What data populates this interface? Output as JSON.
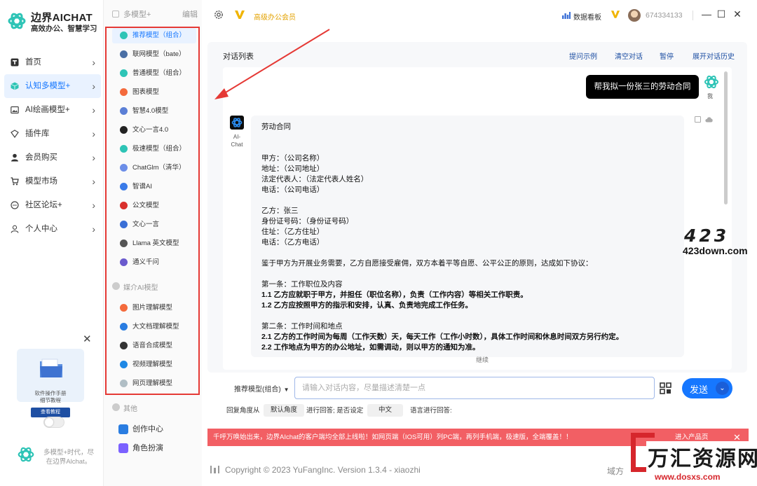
{
  "brand": {
    "name": "边界AICHAT",
    "slogan": "高效办公、智慧学习"
  },
  "nav": [
    {
      "label": "首页",
      "icon": "home-icon"
    },
    {
      "label": "认知多模型+",
      "icon": "cube-icon",
      "active": true
    },
    {
      "label": "AI绘画模型+",
      "icon": "image-icon"
    },
    {
      "label": "插件库",
      "icon": "plugin-icon"
    },
    {
      "label": "会员购买",
      "icon": "user-icon"
    },
    {
      "label": "模型市场",
      "icon": "cart-icon"
    },
    {
      "label": "社区论坛+",
      "icon": "chat-bubble-icon"
    },
    {
      "label": "个人中心",
      "icon": "person-icon"
    }
  ],
  "promo": {
    "line1": "软件操作手册",
    "line2": "细节教程",
    "button": "查看教程"
  },
  "nav_footer": "多模型+时代，尽在边界Alchat。",
  "models_panel": {
    "title": "多模型+",
    "edit": "编辑",
    "items": [
      {
        "label": "推荐模型（组合）",
        "color": "#2ec4b6"
      },
      {
        "label": "联网模型（bate）",
        "color": "#4a6fa5"
      },
      {
        "label": "普通模型（组合）",
        "color": "#2ec4b6"
      },
      {
        "label": "图表模型",
        "color": "#f46a3c"
      },
      {
        "label": "智慧4.0模型",
        "color": "#5b7fd6"
      },
      {
        "label": "文心一言4.0",
        "color": "#222222"
      },
      {
        "label": "极速模型（组合）",
        "color": "#2ec4b6"
      },
      {
        "label": "ChatGlm（清华）",
        "color": "#6c8ee8"
      },
      {
        "label": "智谱AI",
        "color": "#3a7be8"
      },
      {
        "label": "公文模型",
        "color": "#d9302c"
      },
      {
        "label": "文心一言",
        "color": "#3a6fd6"
      },
      {
        "label": "Llama 英文模型",
        "color": "#555555"
      },
      {
        "label": "通义千问",
        "color": "#6a5acd"
      }
    ],
    "media_title": "媒介AI模型",
    "media_items": [
      {
        "label": "图片理解模型",
        "color": "#f46a3c"
      },
      {
        "label": "大文档理解模型",
        "color": "#2a7de1"
      },
      {
        "label": "语音合成模型",
        "color": "#333333"
      },
      {
        "label": "视频理解模型",
        "color": "#1e88e5"
      },
      {
        "label": "网页理解模型",
        "color": "#b0bec5"
      }
    ],
    "other_title": "其他",
    "other_items": [
      {
        "label": "创作中心",
        "color": "#2a7de1"
      },
      {
        "label": "角色扮演",
        "color": "#7b61ff"
      }
    ]
  },
  "topbar": {
    "vip": "高级办公会员",
    "dashboard": "数据看板",
    "user_id": "674334133"
  },
  "chat": {
    "list_title": "对话列表",
    "actions": [
      "提问示例",
      "清空对话",
      "暂停",
      "展开对话历史"
    ],
    "user_message": "帮我拟一份张三的劳动合同",
    "user_label": "我",
    "ai_label": "AI-Chat",
    "ai_lines": [
      {
        "t": "劳动合同"
      },
      {
        "t": ""
      },
      {
        "t": ""
      },
      {
        "t": "甲方：（公司名称）"
      },
      {
        "t": "地址：（公司地址）"
      },
      {
        "t": "法定代表人：（法定代表人姓名）"
      },
      {
        "t": "电话：（公司电话）"
      },
      {
        "t": ""
      },
      {
        "t": "乙方：张三"
      },
      {
        "t": "身份证号码：（身份证号码）"
      },
      {
        "t": "住址：（乙方住址）"
      },
      {
        "t": "电话：（乙方电话）"
      },
      {
        "t": ""
      },
      {
        "t": "鉴于甲方为开展业务需要，乙方自愿接受雇佣，双方本着平等自愿、公平公正的原则，达成如下协议："
      },
      {
        "t": ""
      },
      {
        "t": "第一条：工作职位及内容"
      },
      {
        "t": "1.1 乙方应就职于甲方，并担任（职位名称），负责（工作内容）等相关工作职责。",
        "b": true
      },
      {
        "t": "1.2 乙方应按照甲方的指示和安排，认真、负责地完成工作任务。",
        "b": true
      },
      {
        "t": ""
      },
      {
        "t": "第二条：工作时间和地点"
      },
      {
        "t": "2.1 乙方的工作时间为每周（工作天数）天，每天工作（工作小时数），具体工作时间和休息时间双方另行约定。",
        "b": true
      },
      {
        "t": "2.2 工作地点为甲方的办公地址，如需调动，则以甲方的通知为准。",
        "b": true
      }
    ],
    "continue": "继续"
  },
  "input": {
    "model_select": "推荐模型(组合)",
    "placeholder": "请输入对话内容，尽量描述清楚一点",
    "send": "发送",
    "angle_label": "回复角度从",
    "angle_value": "默认角度",
    "lang_label": "进行回答; 是否设定",
    "lang_value": "中文",
    "lang_suffix": "语言进行回答:"
  },
  "banner": {
    "text": "千呼万唤始出来，边界AIchat的客户端均全部上线啦！如网页端（IOS可用）列PC端，再列手机端，极速版，全端覆盖！！",
    "right": "进入产品页"
  },
  "footer": {
    "text": "Copyright © 2023 YuFangInc. Version 1.3.4 - xiaozhi",
    "right": "域方"
  },
  "watermarks": {
    "w423": "423",
    "w423_url": "423down.com",
    "wh_title": "万汇资源网",
    "wh_url": "www.dosxs.com"
  },
  "colors": {
    "accent": "#1677ff",
    "banner": "#f25f64",
    "annotation": "#e53935"
  }
}
